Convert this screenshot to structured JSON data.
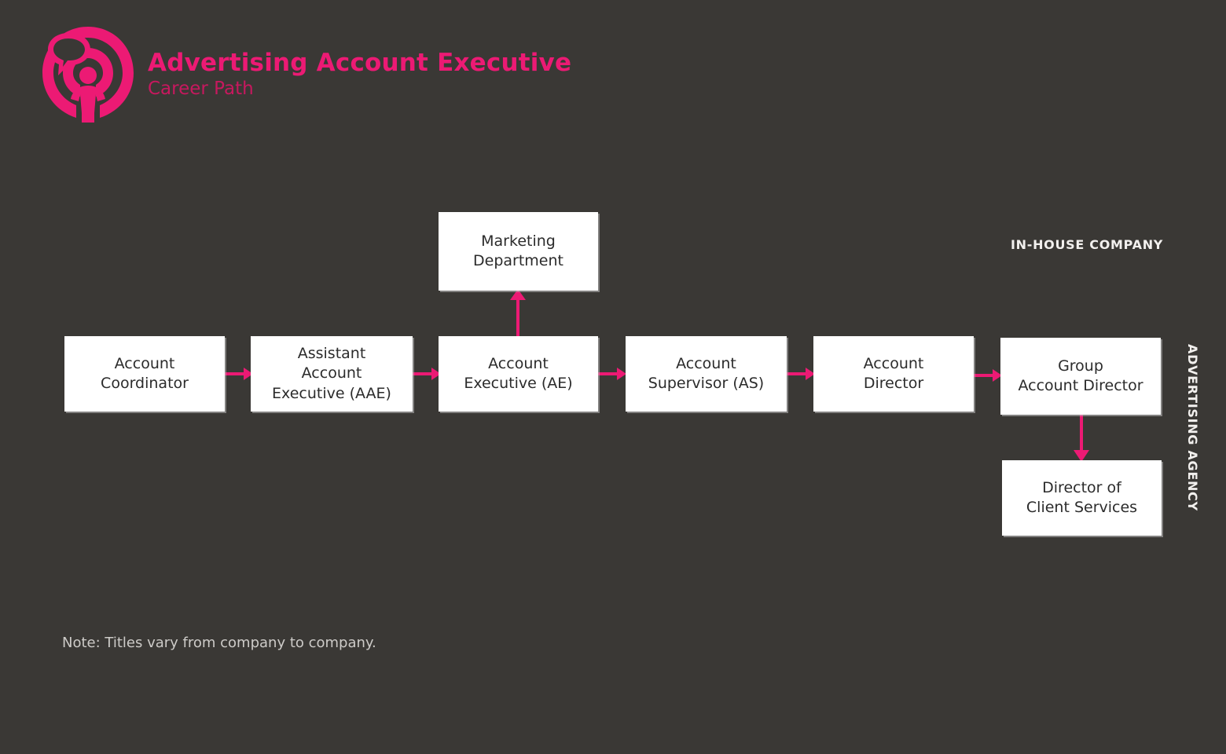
{
  "page": {
    "background_color": "#3a3835",
    "accent_color": "#ec1a74",
    "node_fill_color": "#ffffff",
    "node_text_color": "#2b2b2b",
    "label_text_color": "#f2f0ee"
  },
  "brand": {
    "logo_icon": "broadcast-person-speech-bubble-icon",
    "title": "Advertising Account Executive",
    "subtitle": "Career Path",
    "title_color": "#ec1a74",
    "subtitle_color": "#c7185e"
  },
  "diagram": {
    "type": "flowchart",
    "nodes": [
      {
        "id": "account-coordinator",
        "label": "Account\nCoordinator"
      },
      {
        "id": "assistant-account-exec",
        "label": "Assistant\nAccount\nExecutive (AAE)"
      },
      {
        "id": "account-executive",
        "label": "Account\nExecutive (AE)"
      },
      {
        "id": "marketing-department",
        "label": "Marketing\nDepartment"
      },
      {
        "id": "account-supervisor",
        "label": "Account\nSupervisor (AS)"
      },
      {
        "id": "account-director",
        "label": "Account\nDirector"
      },
      {
        "id": "group-account-director",
        "label": "Group\nAccount Director"
      },
      {
        "id": "director-client-services",
        "label": "Director of\nClient Services"
      }
    ],
    "edges": [
      {
        "from": "account-coordinator",
        "to": "assistant-account-exec",
        "direction": "right"
      },
      {
        "from": "assistant-account-exec",
        "to": "account-executive",
        "direction": "right"
      },
      {
        "from": "account-executive",
        "to": "account-supervisor",
        "direction": "right"
      },
      {
        "from": "account-executive",
        "to": "marketing-department",
        "direction": "up"
      },
      {
        "from": "account-supervisor",
        "to": "account-director",
        "direction": "right"
      },
      {
        "from": "account-director",
        "to": "group-account-director",
        "direction": "right"
      },
      {
        "from": "group-account-director",
        "to": "director-client-services",
        "direction": "down"
      }
    ]
  },
  "regions": {
    "in_house": "IN-HOUSE COMPANY",
    "agency": "ADVERTISING AGENCY"
  },
  "footnote": {
    "text": "Note: Titles vary from company to company."
  }
}
